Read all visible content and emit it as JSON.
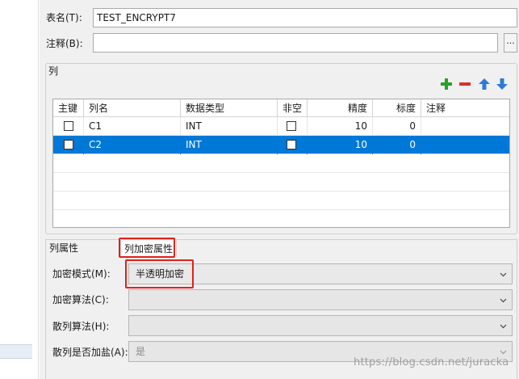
{
  "form": {
    "table_name_label": "表名(T):",
    "table_name_value": "TEST_ENCRYPT7",
    "comment_label": "注释(B):",
    "comment_value": "",
    "browse_label": "..."
  },
  "columns_group": {
    "title": "列",
    "toolbar": [
      "add-icon",
      "remove-icon",
      "move-up-icon",
      "move-down-icon"
    ],
    "headers": [
      "主键",
      "列名",
      "数据类型",
      "非空",
      "精度",
      "标度",
      "注释"
    ],
    "rows": [
      {
        "pk": false,
        "name": "C1",
        "type": "INT",
        "not_null": false,
        "precision": "10",
        "scale": "0",
        "comment": "",
        "selected": false
      },
      {
        "pk": false,
        "name": "C2",
        "type": "INT",
        "not_null": false,
        "precision": "10",
        "scale": "0",
        "comment": "",
        "selected": true
      }
    ]
  },
  "tabs": {
    "column_props": "列属性",
    "encrypt_props": "列加密属性",
    "active": "encrypt_props"
  },
  "encrypt": {
    "mode_label": "加密模式(M):",
    "mode_value": "半透明加密",
    "algo_label": "加密算法(C):",
    "algo_value": "",
    "hash_label": "散列算法(H):",
    "hash_value": "",
    "salt_label": "散列是否加盐(A):",
    "salt_value": "是"
  },
  "watermark": "https://blog.csdn.net/juracka",
  "colors": {
    "accent": "#0078d7",
    "highlight_red": "#e0211a",
    "add_green": "#2aa12a",
    "remove_red": "#d8302f",
    "arrow_blue": "#2b7bd6"
  }
}
